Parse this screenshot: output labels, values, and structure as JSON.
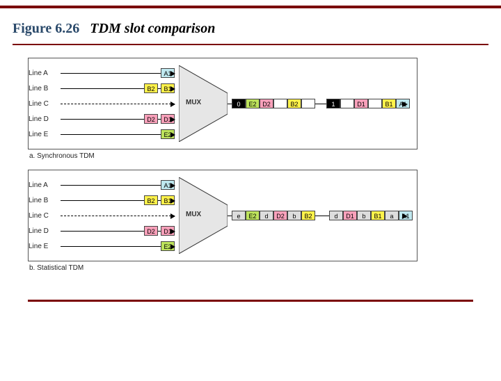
{
  "figure": {
    "number": "Figure 6.26",
    "caption": "TDM slot comparison"
  },
  "mux_label": "MUX",
  "lines": {
    "A": "Line A",
    "B": "Line B",
    "C": "Line C",
    "D": "Line D",
    "E": "Line E"
  },
  "inputs": {
    "A": [
      {
        "text": "A1",
        "color": "cyan"
      }
    ],
    "B": [
      {
        "text": "B2",
        "color": "yellow"
      },
      {
        "text": "B1",
        "color": "yellow"
      }
    ],
    "C": [],
    "D": [
      {
        "text": "D2",
        "color": "pink"
      },
      {
        "text": "D1",
        "color": "pink"
      }
    ],
    "E": [
      {
        "text": "E2",
        "color": "green"
      }
    ]
  },
  "panels": {
    "sync": {
      "caption": "a. Synchronous TDM",
      "frames": [
        [
          {
            "text": "0",
            "color": "black"
          },
          {
            "text": "E2",
            "color": "green"
          },
          {
            "text": "D2",
            "color": "pink"
          },
          {
            "text": "",
            "color": "white"
          },
          {
            "text": "B2",
            "color": "yellow"
          },
          {
            "text": "",
            "color": "white"
          }
        ],
        [
          {
            "text": "1",
            "color": "black"
          },
          {
            "text": "",
            "color": "white"
          },
          {
            "text": "D1",
            "color": "pink"
          },
          {
            "text": "",
            "color": "white"
          },
          {
            "text": "B1",
            "color": "yellow"
          },
          {
            "text": "A1",
            "color": "cyan"
          }
        ]
      ]
    },
    "stat": {
      "caption": "b. Statistical TDM",
      "frames": [
        [
          {
            "text": "e",
            "color": "grey"
          },
          {
            "text": "E2",
            "color": "green"
          },
          {
            "text": "d",
            "color": "grey"
          },
          {
            "text": "D2",
            "color": "pink"
          },
          {
            "text": "b",
            "color": "grey"
          },
          {
            "text": "B2",
            "color": "yellow"
          }
        ],
        [
          {
            "text": "d",
            "color": "grey"
          },
          {
            "text": "D1",
            "color": "pink"
          },
          {
            "text": "b",
            "color": "grey"
          },
          {
            "text": "B1",
            "color": "yellow"
          },
          {
            "text": "a",
            "color": "grey"
          },
          {
            "text": "A1",
            "color": "cyan"
          }
        ]
      ]
    }
  }
}
